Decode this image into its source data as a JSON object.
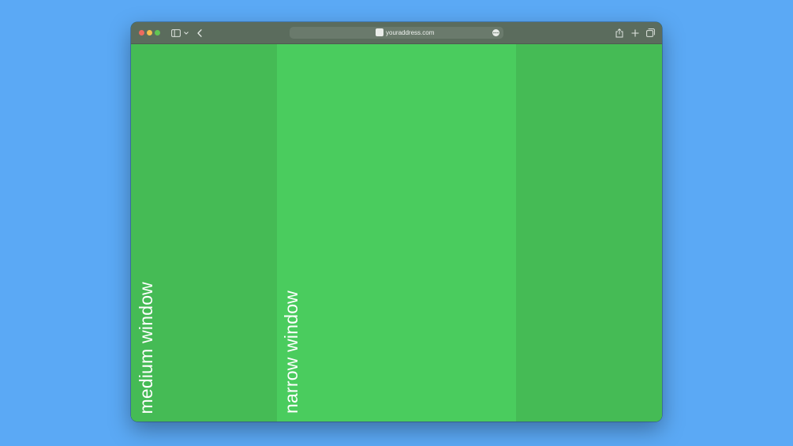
{
  "browser": {
    "url": "youraddress.com",
    "toolbar_icons": {
      "sidebar": "sidebar-icon",
      "sidebar_menu": "chevron-down-icon",
      "back": "chevron-left-icon",
      "more": "ellipsis-icon",
      "share": "share-icon",
      "new_tab": "plus-icon",
      "tab_overview": "tabs-icon"
    }
  },
  "page": {
    "columns": [
      {
        "label": "medium window",
        "color": "#45bb55"
      },
      {
        "label": "narrow window",
        "color": "#4acc5e"
      },
      {
        "label": "",
        "color": "#45bb55"
      }
    ]
  },
  "colors": {
    "desktop": "#5ba9f5",
    "toolbar": "#5b6c5d",
    "close": "#ed6a5e",
    "minimize": "#f5bf4f",
    "maximize": "#61c554"
  }
}
